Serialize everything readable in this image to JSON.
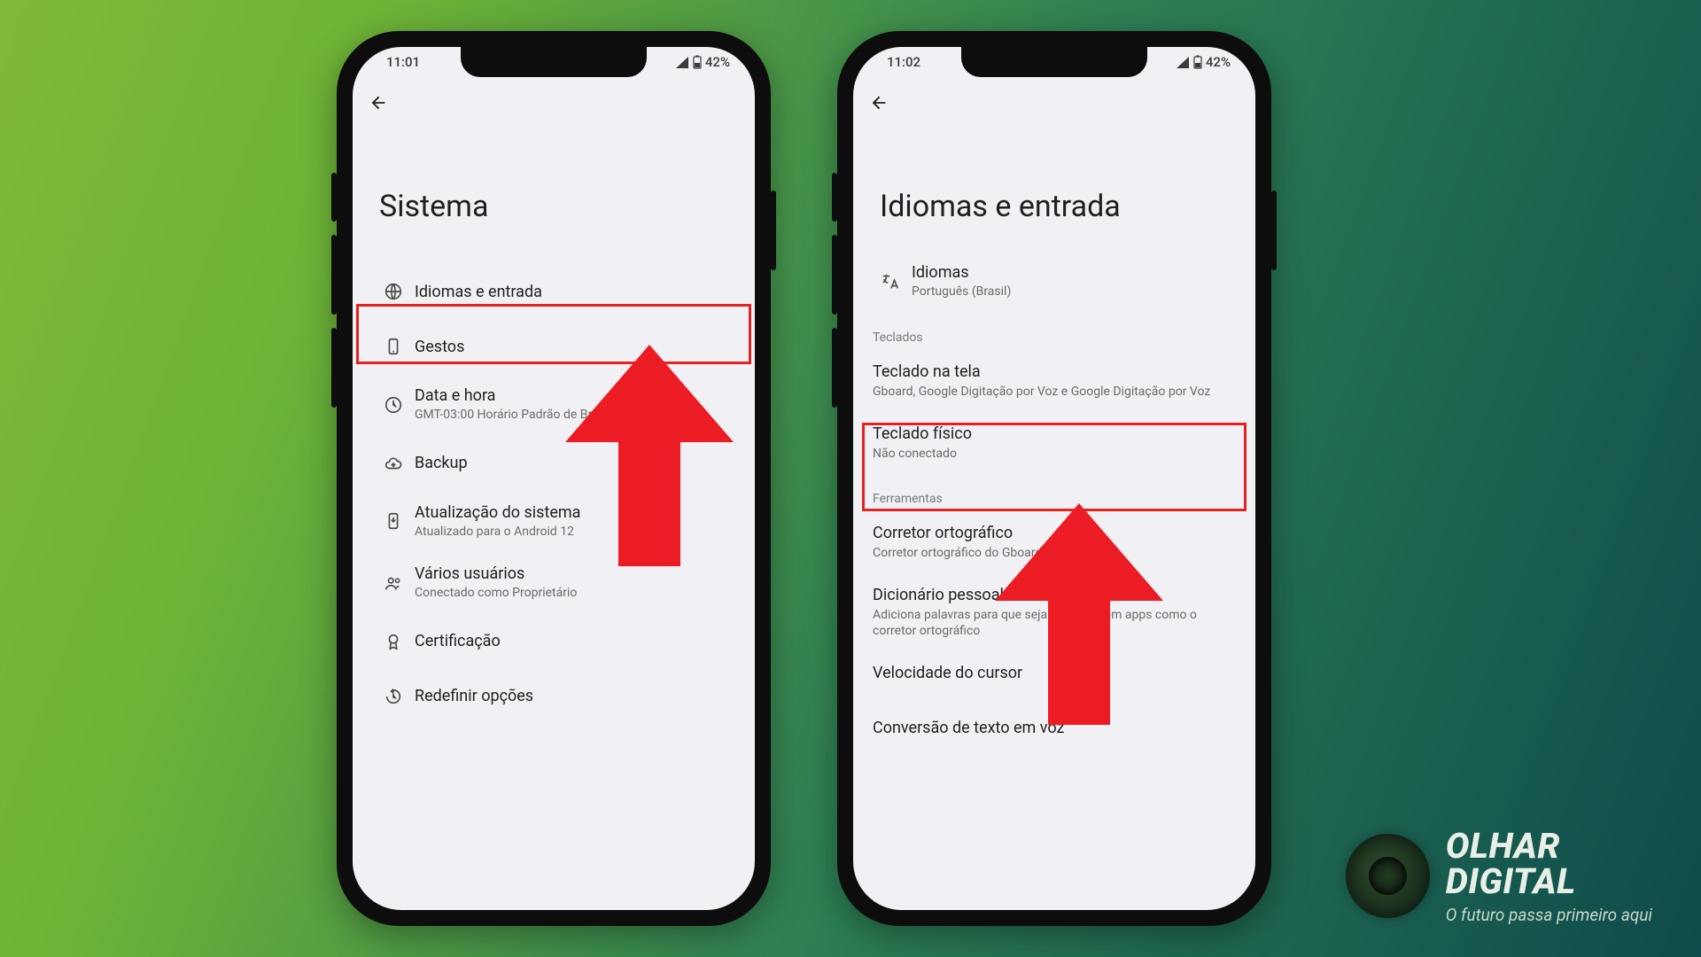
{
  "colors": {
    "highlight": "#e52220",
    "arrow": "#eb1c24"
  },
  "brand": {
    "line1": "OLHAR",
    "line2": "DIGITAL",
    "tagline": "O futuro passa primeiro aqui"
  },
  "left": {
    "status": {
      "time": "11:01",
      "battery": "42%"
    },
    "page_title": "Sistema",
    "items": [
      {
        "icon": "globe",
        "title": "Idiomas e entrada",
        "sub": ""
      },
      {
        "icon": "gesture",
        "title": "Gestos",
        "sub": ""
      },
      {
        "icon": "clock",
        "title": "Data e hora",
        "sub": "GMT-03:00 Horário Padrão de Br..."
      },
      {
        "icon": "cloud",
        "title": "Backup",
        "sub": ""
      },
      {
        "icon": "update",
        "title": "Atualização do sistema",
        "sub": "Atualizado para o Android 12"
      },
      {
        "icon": "users",
        "title": "Vários usuários",
        "sub": "Conectado como Proprietário"
      },
      {
        "icon": "award",
        "title": "Certificação",
        "sub": ""
      },
      {
        "icon": "restore",
        "title": "Redefinir opções",
        "sub": ""
      }
    ]
  },
  "right": {
    "status": {
      "time": "11:02",
      "battery": "42%"
    },
    "page_title": "Idiomas e entrada",
    "lang": {
      "title": "Idiomas",
      "sub": "Português (Brasil)"
    },
    "section1": "Teclados",
    "items1": [
      {
        "title": "Teclado na tela",
        "sub": "Gboard, Google Digitação por Voz e Google Digitação por Voz"
      },
      {
        "title": "Teclado físico",
        "sub": "Não conectado"
      }
    ],
    "section2": "Ferramentas",
    "items2": [
      {
        "title": "Corretor ortográfico",
        "sub": "Corretor ortográfico do Gboard"
      },
      {
        "title": "Dicionário pessoal",
        "sub": "Adiciona palavras para que sejam usadas em apps como o corretor ortográfico"
      },
      {
        "title": "Velocidade do cursor",
        "sub": ""
      },
      {
        "title": "Conversão de texto em voz",
        "sub": ""
      }
    ]
  }
}
